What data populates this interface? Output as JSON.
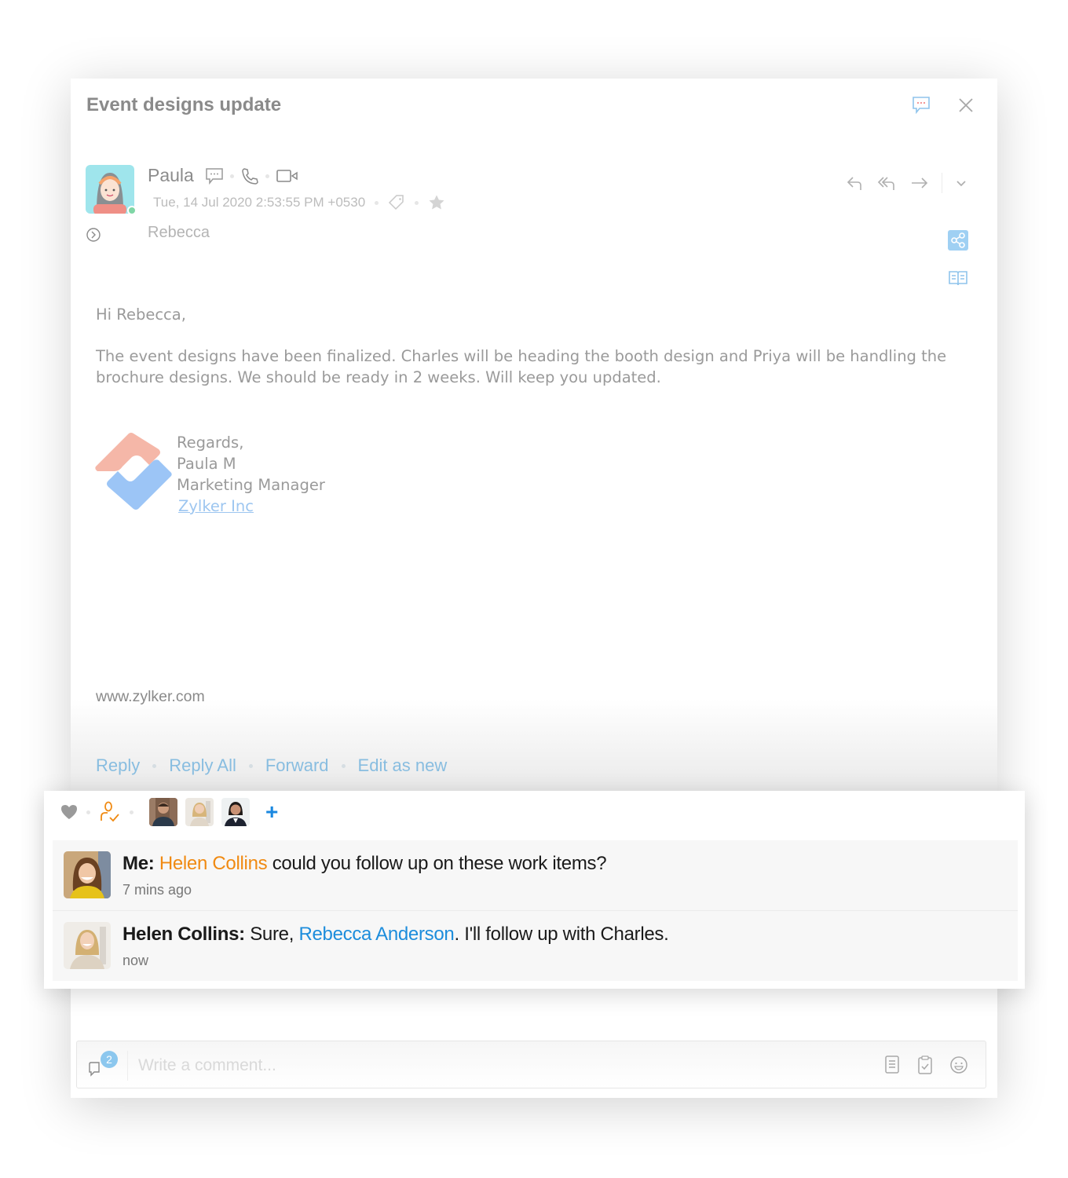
{
  "mail": {
    "subject": "Event designs update",
    "sender": {
      "name": "Paula",
      "status": "online",
      "date": "Tue, 14 Jul 2020 2:53:55 PM +0530"
    },
    "to": "Rebecca",
    "body": {
      "greeting": "Hi Rebecca,",
      "paragraph": "The event designs have been finalized. Charles will be heading the booth design and Priya will be handling the brochure designs. We should be ready in 2 weeks. Will keep you updated."
    },
    "signature": {
      "lines": [
        "Regards,",
        "Paula M",
        "Marketing Manager"
      ],
      "company_link": "Zylker Inc"
    },
    "website": "www.zylker.com",
    "actions": [
      "Reply",
      "Reply All",
      "Forward",
      "Edit as new"
    ]
  },
  "icons": {
    "chat": "chat-bubble-icon",
    "close": "close-icon",
    "call": "phone-icon",
    "video": "video-icon",
    "tag": "tag-icon",
    "star": "star-icon",
    "reply": "reply-icon",
    "reply_all": "reply-all-icon",
    "forward": "forward-icon",
    "more": "chevron-down-icon",
    "share": "share-icon",
    "reading": "book-icon"
  },
  "comments_panel": {
    "participants": [
      "participant-1",
      "participant-2",
      "participant-3"
    ],
    "add_label": "+",
    "comments": [
      {
        "author": "Me:",
        "mention": "Helen Collins",
        "text": "could you follow up on these work items?",
        "time": "7 mins ago"
      },
      {
        "author": "Helen Collins:",
        "text_before": "Sure,",
        "mention": "Rebecca Anderson",
        "text_after": ". I'll follow up with Charles.",
        "time": "now"
      }
    ]
  },
  "composer": {
    "comment_count": "2",
    "placeholder": "Write a comment..."
  },
  "colors": {
    "accent_blue": "#1d8ddc",
    "mention_orange": "#f08a12",
    "link_blue": "#88bde0",
    "online_green": "#7fd6a6"
  }
}
